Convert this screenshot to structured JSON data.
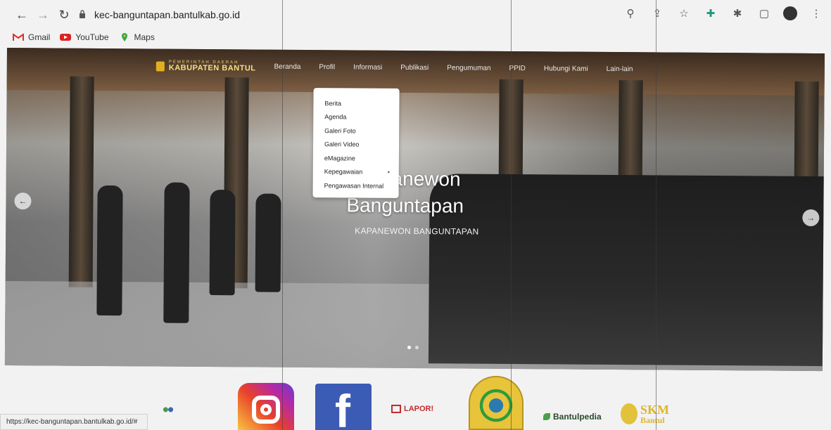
{
  "browser": {
    "url": "kec-banguntapan.bantulkab.go.id",
    "status_url": "https://kec-banguntapan.bantulkab.go.id/#",
    "icons": [
      "back-icon",
      "forward-icon",
      "reload-icon",
      "lock-icon",
      "zoom-icon",
      "share-icon",
      "star-icon",
      "extension-pin-icon",
      "puzzle-icon",
      "sidebar-icon",
      "profile-avatar",
      "menu-icon"
    ]
  },
  "bookmarks": [
    {
      "label": "Gmail",
      "color": "#d93025"
    },
    {
      "label": "YouTube",
      "color": "#e02020"
    },
    {
      "label": "Maps",
      "color": "#34a853"
    }
  ],
  "site": {
    "logo_small": "PEMERINTAH DAERAH",
    "logo_big": "KABUPATEN BANTUL",
    "nav": [
      "Beranda",
      "Profil",
      "Informasi",
      "Publikasi",
      "Pengumuman",
      "PPID",
      "Hubungi Kami",
      "Lain-lain"
    ],
    "dropdown": [
      "Berita",
      "Agenda",
      "Galeri Foto",
      "Galeri Video",
      "eMagazine",
      "Kepegawaian",
      "Pengawasan Internal"
    ],
    "hero_title_line1": "Kapanewon",
    "hero_title_line2": "Banguntapan",
    "hero_subtitle": "KAPANEWON BANGUNTAPAN",
    "slide_count": 2,
    "active_slide": 1
  },
  "footer_logos": {
    "lapor": "LAPOR!",
    "bantulpedia": "Bantulpedia",
    "skm_big": "SKM",
    "skm_small": "Bantul"
  }
}
